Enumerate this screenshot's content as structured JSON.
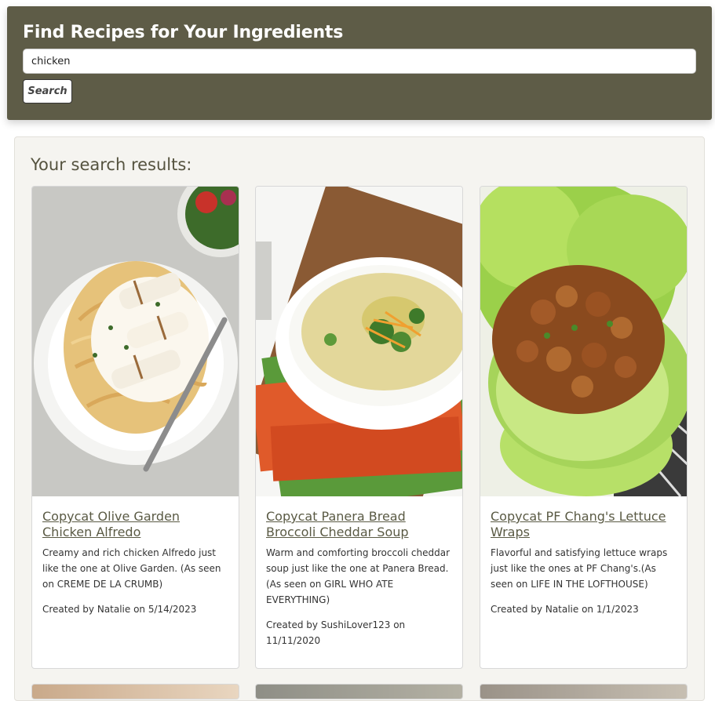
{
  "header": {
    "title": "Find Recipes for Your Ingredients",
    "search_value": "chicken",
    "search_button": "Search"
  },
  "results": {
    "heading": "Your search results:",
    "recipes": [
      {
        "title": "Copycat Olive Garden Chicken Alfredo",
        "description": "Creamy and rich chicken Alfredo just like the one at Olive Garden. (As seen on CREME DE LA CRUMB)",
        "meta": "Created by Natalie on 5/14/2023",
        "image": "chicken-alfredo-photo"
      },
      {
        "title": "Copycat Panera Bread Broccoli Cheddar Soup",
        "description": "Warm and comforting broccoli cheddar soup just like the one at Panera Bread. (As seen on GIRL WHO ATE EVERYTHING)",
        "meta": "Created by SushiLover123 on 11/11/2020",
        "image": "broccoli-cheddar-soup-photo"
      },
      {
        "title": "Copycat PF Chang's Lettuce Wraps",
        "description": "Flavorful and satisfying lettuce wraps just like the ones at PF Chang's.(As seen on LIFE IN THE LOFTHOUSE)",
        "meta": "Created by Natalie on 1/1/2023",
        "image": "lettuce-wraps-photo"
      }
    ]
  },
  "colors": {
    "header_bg": "#5e5c47",
    "link": "#5a5a44",
    "panel_bg": "#f5f4f0"
  }
}
